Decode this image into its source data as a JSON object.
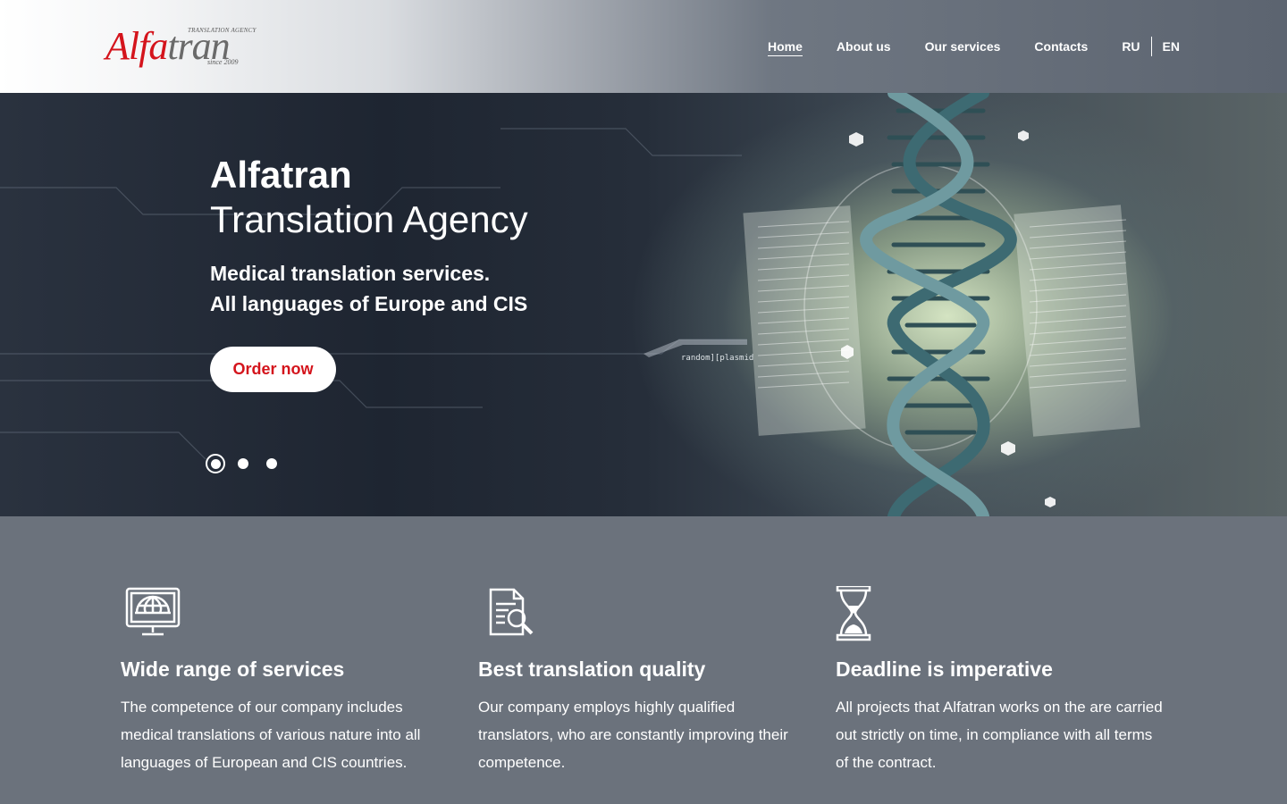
{
  "brand": {
    "tagline_top": "TRANSLATION AGENCY",
    "wordmark_red": "Alfa",
    "wordmark_gray": "tran",
    "tagline_bottom": "since 2009",
    "colors": {
      "accent": "#d4141c",
      "logo_gray": "#6a6a6a"
    }
  },
  "nav": {
    "items": [
      {
        "label": "Home",
        "active": true
      },
      {
        "label": "About us",
        "active": false
      },
      {
        "label": "Our services",
        "active": false
      },
      {
        "label": "Contacts",
        "active": false
      }
    ],
    "languages": [
      "RU",
      "EN"
    ]
  },
  "hero": {
    "title_bold": "Alfatran",
    "title_light": "Translation Agency",
    "subtitle_line1": "Medical translation services.",
    "subtitle_line2": "All languages of Europe and CIS",
    "cta_label": "Order now",
    "code_label": "random][plasmid",
    "slides": {
      "count": 3,
      "active_index": 0
    }
  },
  "features": [
    {
      "icon": "monitor-globe-icon",
      "title": "Wide range of services",
      "text": "The competence of our company includes medical translations of various nature into all languages of European and CIS countries."
    },
    {
      "icon": "document-search-icon",
      "title": "Best translation quality",
      "text": "Our company employs highly qualified translators, who are constantly improving their competence."
    },
    {
      "icon": "hourglass-icon",
      "title": "Deadline is imperative",
      "text": "All projects that Alfatran works on the are carried out strictly on time, in compliance with all terms of the contract."
    }
  ]
}
